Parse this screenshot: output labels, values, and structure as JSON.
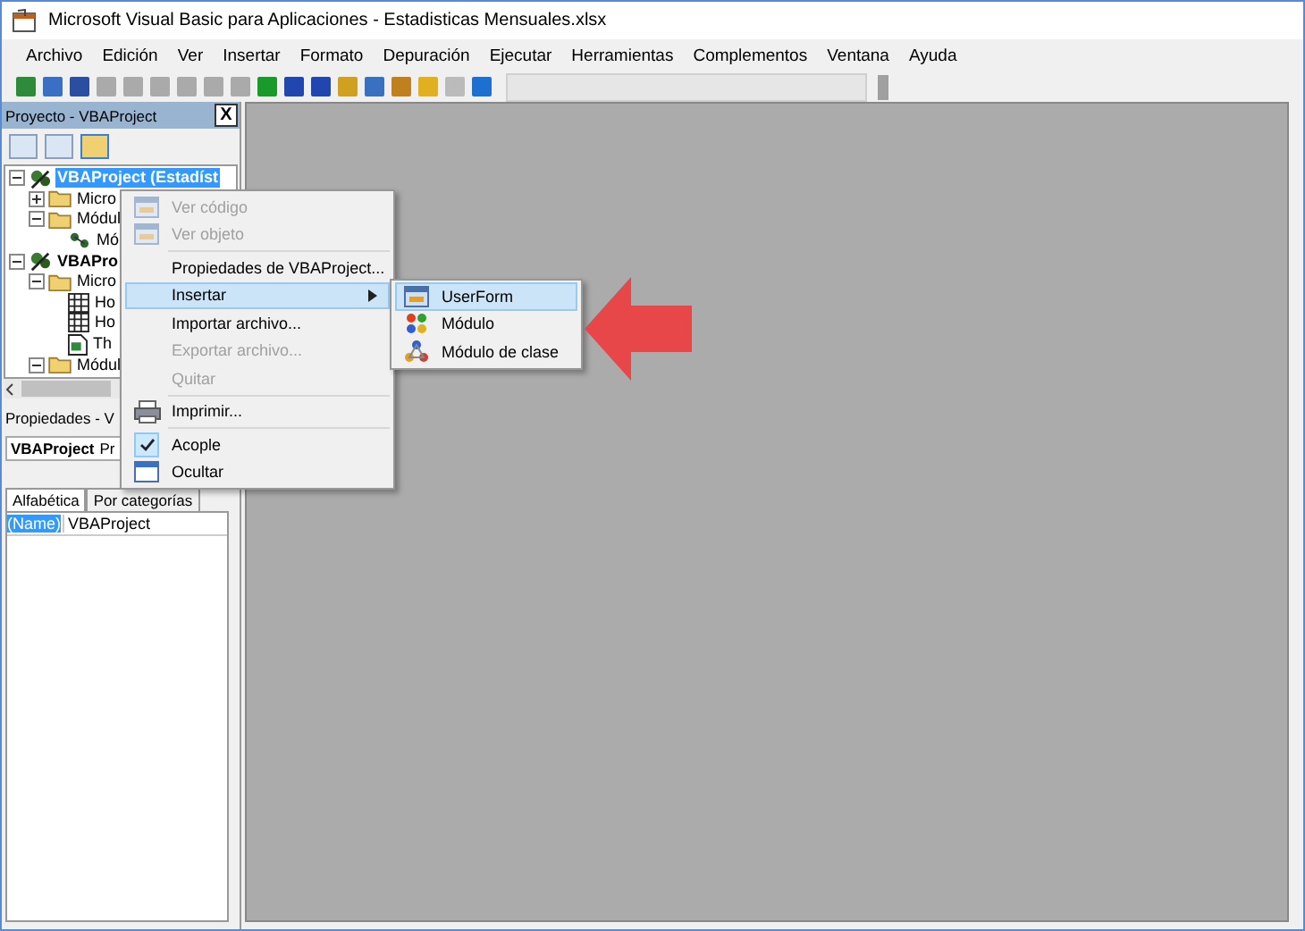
{
  "window": {
    "title": "Microsoft Visual Basic para Aplicaciones - Estadisticas Mensuales.xlsx"
  },
  "menu_bar": [
    "Archivo",
    "Edición",
    "Ver",
    "Insertar",
    "Formato",
    "Depuración",
    "Ejecutar",
    "Herramientas",
    "Complementos",
    "Ventana",
    "Ayuda"
  ],
  "project_panel": {
    "title": "Proyecto - VBAProject",
    "close": "X",
    "tree": [
      {
        "label": "VBAProject (Estadíst",
        "kind": "project",
        "selected": true,
        "expanded": true,
        "children": [
          {
            "label": "Micro",
            "kind": "folder",
            "selected": false,
            "expanded": false
          },
          {
            "label": "Módul",
            "kind": "folder",
            "selected": false,
            "expanded": true,
            "children": [
              {
                "label": "Mó",
                "kind": "module",
                "selected": false
              }
            ]
          }
        ]
      },
      {
        "label": "VBAPro",
        "kind": "project",
        "selected": false,
        "expanded": true,
        "children": [
          {
            "label": "Micro",
            "kind": "folder",
            "selected": false,
            "expanded": true,
            "children": [
              {
                "label": "Ho",
                "kind": "sheet",
                "selected": false
              },
              {
                "label": "Ho",
                "kind": "sheet",
                "selected": false
              },
              {
                "label": "Th",
                "kind": "workbook",
                "selected": false
              }
            ]
          },
          {
            "label": "Módul",
            "kind": "folder",
            "selected": false,
            "expanded": true
          }
        ]
      }
    ]
  },
  "properties_panel": {
    "title": "Propiedades - V",
    "object": "VBAProject",
    "object_type": "Pr",
    "tabs": [
      {
        "label": "Alfabética",
        "selected": true
      },
      {
        "label": "Por categorías",
        "selected": false
      }
    ],
    "rows": [
      {
        "name": "(Name)",
        "value": "VBAProject",
        "selected": true
      }
    ]
  },
  "context_menu": [
    {
      "label": "Ver código",
      "kind": "item",
      "disabled": true,
      "checked": false,
      "selected": false
    },
    {
      "label": "Ver objeto",
      "kind": "item",
      "disabled": true,
      "checked": false,
      "selected": false
    },
    {
      "kind": "separator"
    },
    {
      "label": "Propiedades de VBAProject...",
      "kind": "item",
      "disabled": false,
      "checked": false,
      "selected": false
    },
    {
      "label": "Insertar",
      "kind": "submenu",
      "disabled": false,
      "checked": false,
      "selected": true
    },
    {
      "label": "Importar archivo...",
      "kind": "item",
      "disabled": false,
      "checked": false,
      "selected": false
    },
    {
      "label": "Exportar archivo...",
      "kind": "item",
      "disabled": true,
      "checked": false,
      "selected": false
    },
    {
      "label": "Quitar",
      "kind": "item",
      "disabled": true,
      "checked": false,
      "selected": false
    },
    {
      "kind": "separator"
    },
    {
      "label": "Imprimir...",
      "kind": "item",
      "disabled": false,
      "checked": false,
      "selected": false
    },
    {
      "kind": "separator"
    },
    {
      "label": "Acople",
      "kind": "item",
      "disabled": false,
      "checked": true,
      "selected": false
    },
    {
      "label": "Ocultar",
      "kind": "item",
      "disabled": false,
      "checked": false,
      "selected": false
    }
  ],
  "submenu": [
    {
      "label": "UserForm",
      "selected": true
    },
    {
      "label": "Módulo",
      "selected": false
    },
    {
      "label": "Módulo de clase",
      "selected": false
    }
  ]
}
